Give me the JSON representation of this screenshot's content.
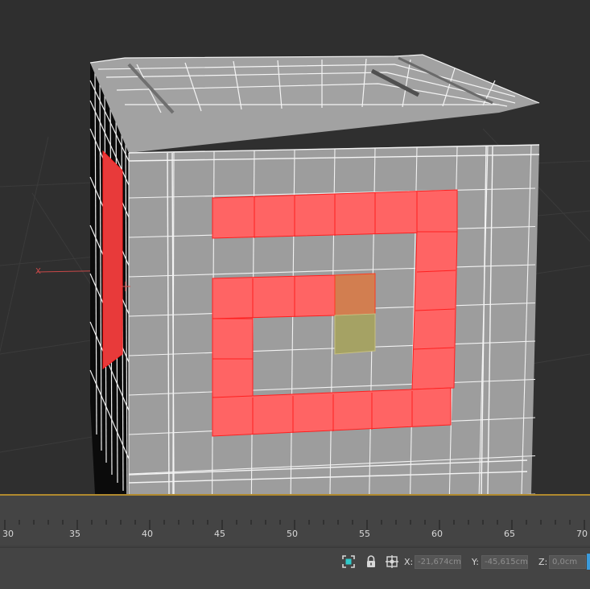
{
  "viewport": {
    "background_color": "#2f2f2f",
    "object_color": "#9d9d9d",
    "wire_color": "#f2f2f2",
    "selection_color": "#ff6464",
    "selection_edge_color": "#ff2020",
    "highlight_colors": {
      "orange": "#d27e50",
      "yellow": "#a5a264"
    },
    "axis_label": "X"
  },
  "timeline": {
    "ticks": [
      "30",
      "35",
      "40",
      "45",
      "50",
      "55",
      "60",
      "65",
      "70"
    ],
    "accent_color": "#b08a2e"
  },
  "status_bar": {
    "icons": [
      "selection-filter-icon",
      "lock-icon",
      "transform-mode-icon"
    ],
    "x_label": "X:",
    "x_value": "-21,674cm",
    "y_label": "Y:",
    "y_value": "-45,615cm",
    "z_label": "Z:",
    "z_value": "0,0cm"
  }
}
